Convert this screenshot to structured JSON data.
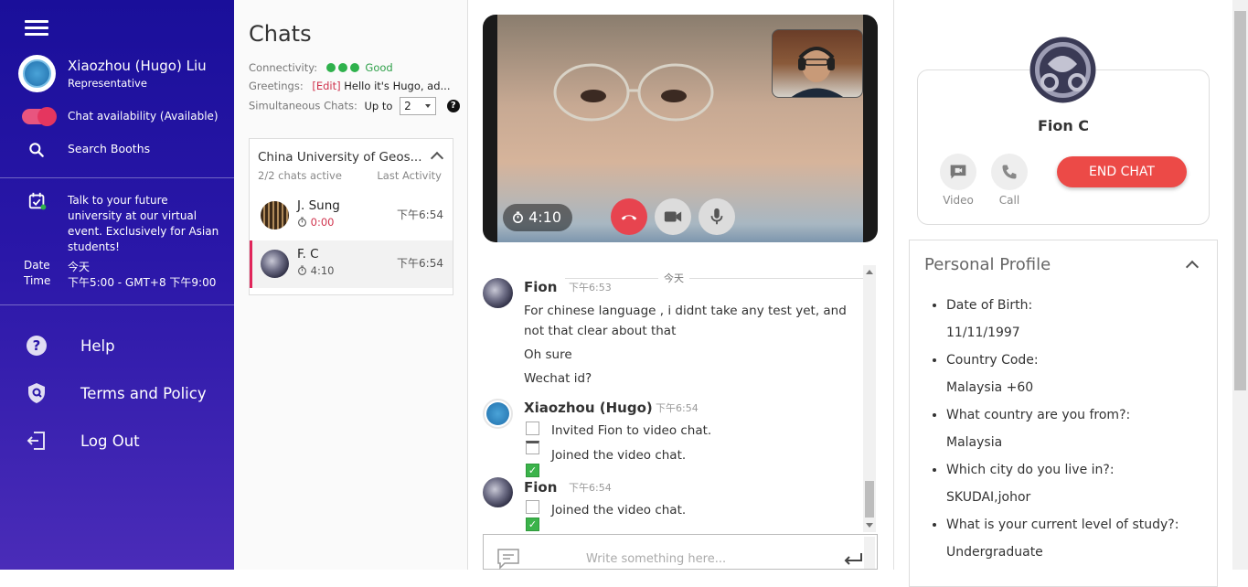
{
  "sidebar": {
    "rep_name": "Xiaozhou (Hugo) Liu",
    "rep_role": "Representative",
    "availability_label": "Chat availability (Available)",
    "search_label": "Search Booths",
    "event_text": "Talk to your future university at our virtual event. Exclusively for Asian students!",
    "date_label": "Date",
    "time_label": "Time",
    "date_value": "今天",
    "time_value": "下午5:00 - GMT+8 下午9:00",
    "nav": [
      {
        "label": "Help",
        "icon": "help-icon"
      },
      {
        "label": "Terms and Policy",
        "icon": "shield-icon"
      },
      {
        "label": "Log Out",
        "icon": "logout-icon"
      }
    ]
  },
  "chats": {
    "title": "Chats",
    "connectivity_label": "Connectivity:",
    "connectivity_value": "Good",
    "greetings_label": "Greetings:",
    "greetings_edit": "[Edit]",
    "greetings_value": "Hello it's Hugo, ad...",
    "simul_label": "Simultaneous Chats:",
    "simul_prefix": "Up to",
    "simul_value": "2",
    "booth": {
      "title": "China University of Geos...",
      "active": "2/2 chats active",
      "last_activity": "Last Activity",
      "rows": [
        {
          "name": "J. Sung",
          "duration": "0:00",
          "time": "下午6:54"
        },
        {
          "name": "F. C",
          "duration": "4:10",
          "time": "下午6:54"
        }
      ]
    }
  },
  "video": {
    "timer": "4:10"
  },
  "messages": {
    "day_divider": "今天",
    "groups": [
      {
        "sender": "Fion",
        "time": "下午6:53",
        "lines": [
          "For chinese language , i didnt take any test yet, and",
          "not that clear about that",
          "Oh sure",
          "Wechat id?"
        ]
      },
      {
        "sender": "Xiaozhou (Hugo)",
        "time": "下午6:54",
        "items": [
          "Invited Fion to video chat.",
          "Joined the video chat."
        ]
      },
      {
        "sender": "Fion",
        "time": "下午6:54",
        "items": [
          "Joined the video chat."
        ]
      }
    ],
    "composer_placeholder": "Write something here..."
  },
  "profile": {
    "name": "Fion C",
    "video_label": "Video",
    "call_label": "Call",
    "end_chat": "END CHAT",
    "section_title": "Personal Profile",
    "fields": [
      {
        "q": "Date of Birth:",
        "a": "11/11/1997"
      },
      {
        "q": "Country Code:",
        "a": "Malaysia +60"
      },
      {
        "q": "What country are you from?:",
        "a": "Malaysia"
      },
      {
        "q": "Which city do you live in?:",
        "a": "SKUDAI,johor"
      },
      {
        "q": "What is your current level of study?:",
        "a": "Undergraduate"
      }
    ]
  },
  "colors": {
    "sidebar": "#2a17a8",
    "accent_pink": "#e0255a",
    "good_green": "#2fb14c",
    "end_red": "#ec4a47"
  }
}
